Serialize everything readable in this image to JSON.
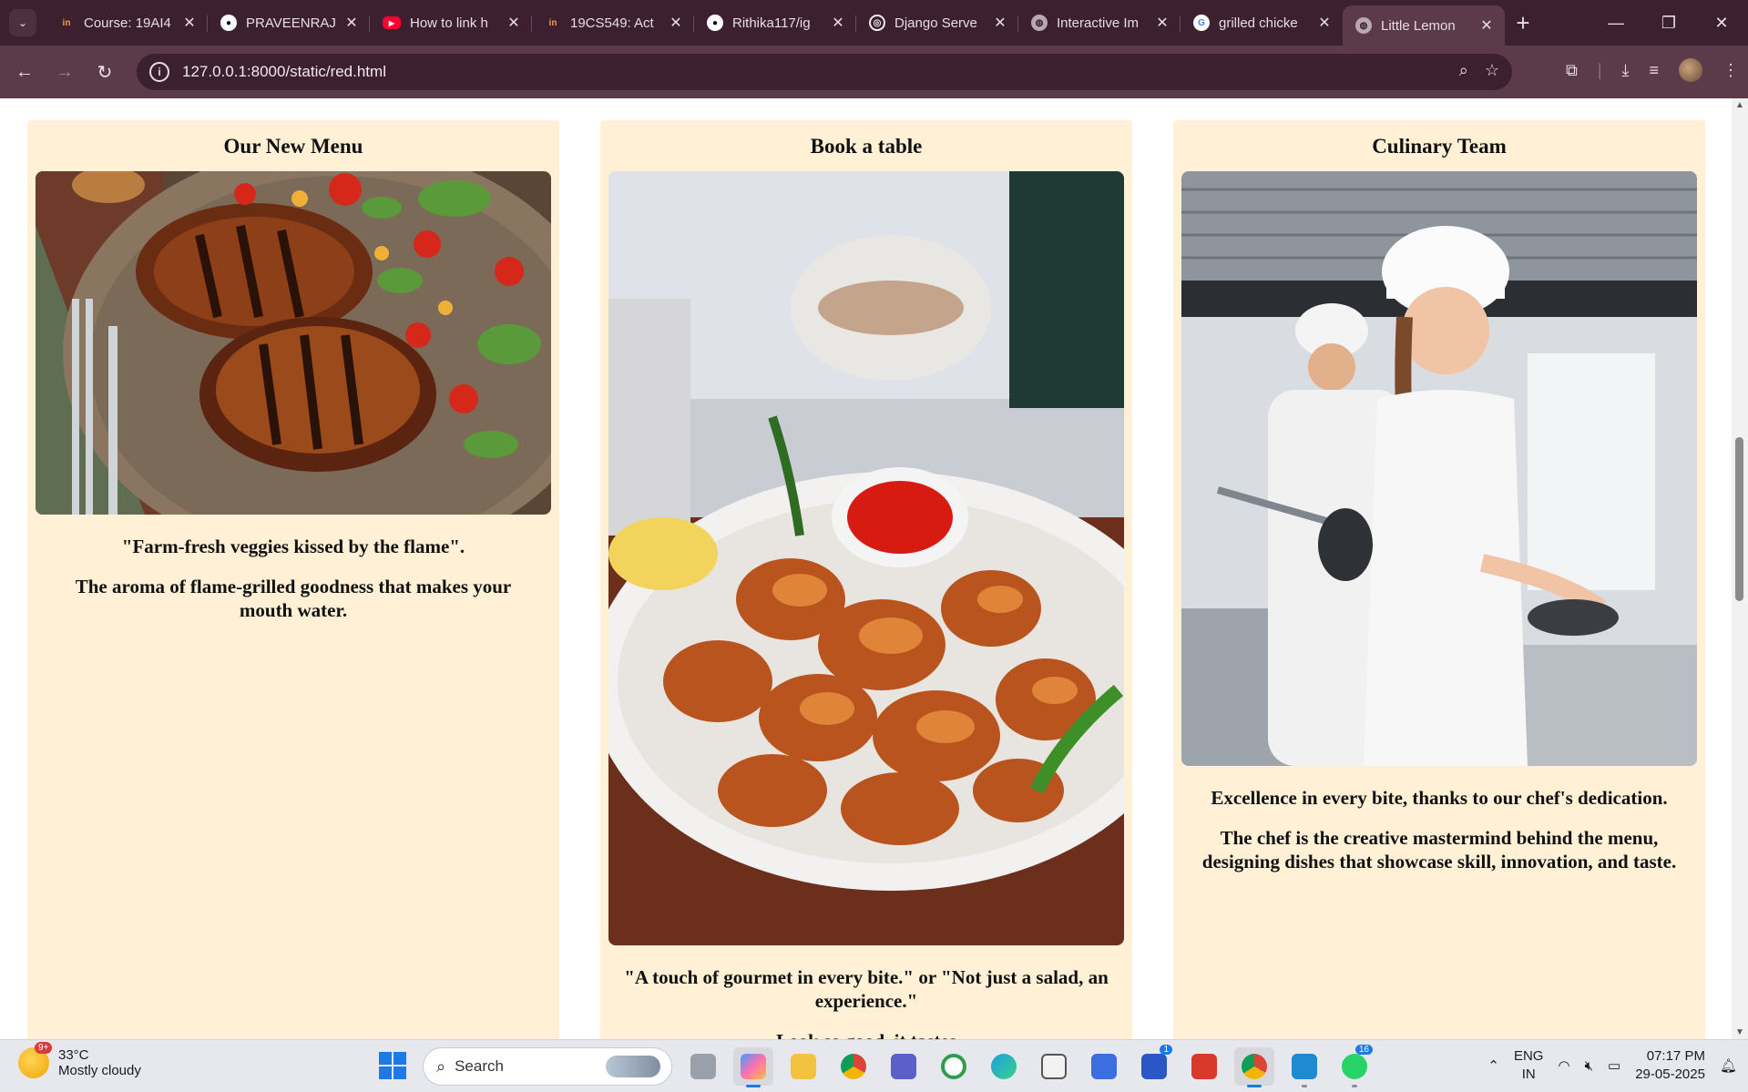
{
  "browser": {
    "tabs": [
      {
        "title": "Course: 19AI4",
        "icon": "coursera-favicon"
      },
      {
        "title": "PRAVEENRAJ",
        "icon": "github-icon"
      },
      {
        "title": "How to link h",
        "icon": "youtube-icon"
      },
      {
        "title": "19CS549: Act",
        "icon": "coursera-favicon"
      },
      {
        "title": "Rithika117/ig",
        "icon": "github-icon"
      },
      {
        "title": "Django Serve",
        "icon": "openai-icon"
      },
      {
        "title": "Interactive Im",
        "icon": "globe-icon"
      },
      {
        "title": "grilled chicke",
        "icon": "google-icon"
      },
      {
        "title": "Little Lemon",
        "icon": "globe-icon"
      }
    ],
    "address": "127.0.0.1:8000/static/red.html"
  },
  "cards": [
    {
      "title": "Our New Menu",
      "quote": "\"Farm-fresh veggies kissed by the flame\".",
      "text": "The aroma of flame-grilled goodness that makes your mouth water."
    },
    {
      "title": "Book a table",
      "quote": "\"A touch of gourmet in every bite.\" or \"Not just a salad, an experience.\"",
      "text": "Look so good, it tastes"
    },
    {
      "title": "Culinary Team",
      "quote": "Excellence in every bite, thanks to our chef's dedication.",
      "text": "The chef is the creative mastermind behind the menu, designing dishes that showcase skill, innovation, and taste."
    }
  ],
  "taskbar": {
    "weather_temp": "33°C",
    "weather_desc": "Mostly cloudy",
    "weather_badge": "9+",
    "search_label": "Search",
    "lang1": "ENG",
    "lang2": "IN",
    "time": "07:17 PM",
    "date": "29-05-2025",
    "badge_l": "1",
    "badge_wa": "16"
  }
}
